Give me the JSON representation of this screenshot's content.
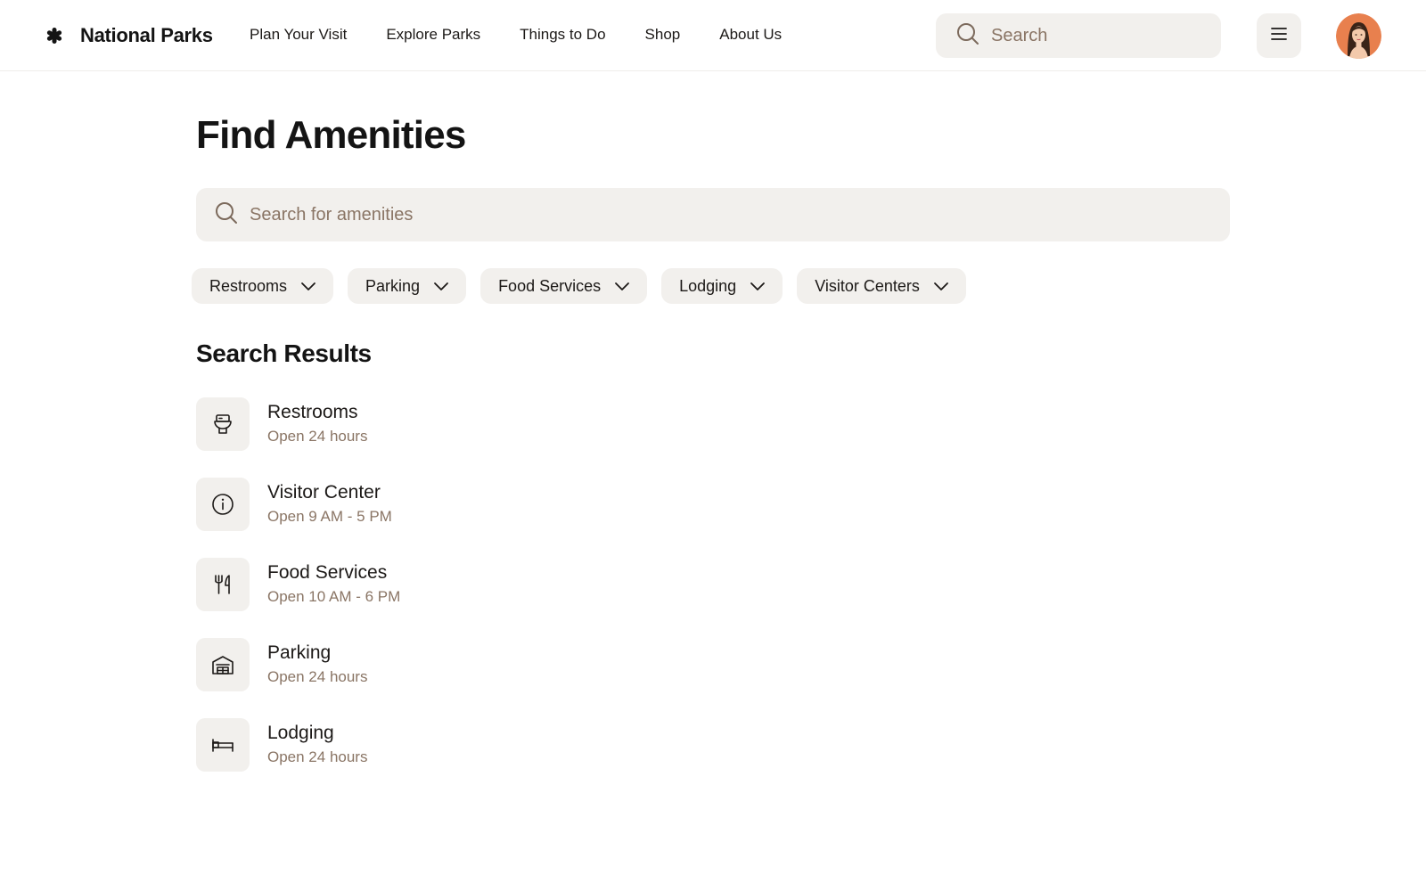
{
  "header": {
    "brand": "National Parks",
    "logo_icon": "asterisk-icon",
    "nav": [
      {
        "label": "Plan Your Visit"
      },
      {
        "label": "Explore Parks"
      },
      {
        "label": "Things to Do"
      },
      {
        "label": "Shop"
      },
      {
        "label": "About Us"
      }
    ],
    "search": {
      "placeholder": "Search",
      "value": ""
    },
    "menu_icon": "menu-icon",
    "avatar_icon": "user-avatar"
  },
  "main": {
    "title": "Find Amenities",
    "search": {
      "placeholder": "Search for amenities",
      "value": ""
    },
    "filters": [
      {
        "label": "Restrooms"
      },
      {
        "label": "Parking"
      },
      {
        "label": "Food Services"
      },
      {
        "label": "Lodging"
      },
      {
        "label": "Visitor Centers"
      }
    ],
    "results_title": "Search Results",
    "results": [
      {
        "name": "Restrooms",
        "hours": "Open 24 hours",
        "icon": "toilet-icon"
      },
      {
        "name": "Visitor Center",
        "hours": "Open 9 AM - 5 PM",
        "icon": "info-icon"
      },
      {
        "name": "Food Services",
        "hours": "Open 10 AM - 6 PM",
        "icon": "fork-knife-icon"
      },
      {
        "name": "Parking",
        "hours": "Open 24 hours",
        "icon": "garage-icon"
      },
      {
        "name": "Lodging",
        "hours": "Open 24 hours",
        "icon": "bed-icon"
      }
    ]
  },
  "colors": {
    "text": "#1c1917",
    "muted": "#8a7565",
    "surface": "#f2f0ed",
    "avatar_bg": "#e8804e"
  }
}
